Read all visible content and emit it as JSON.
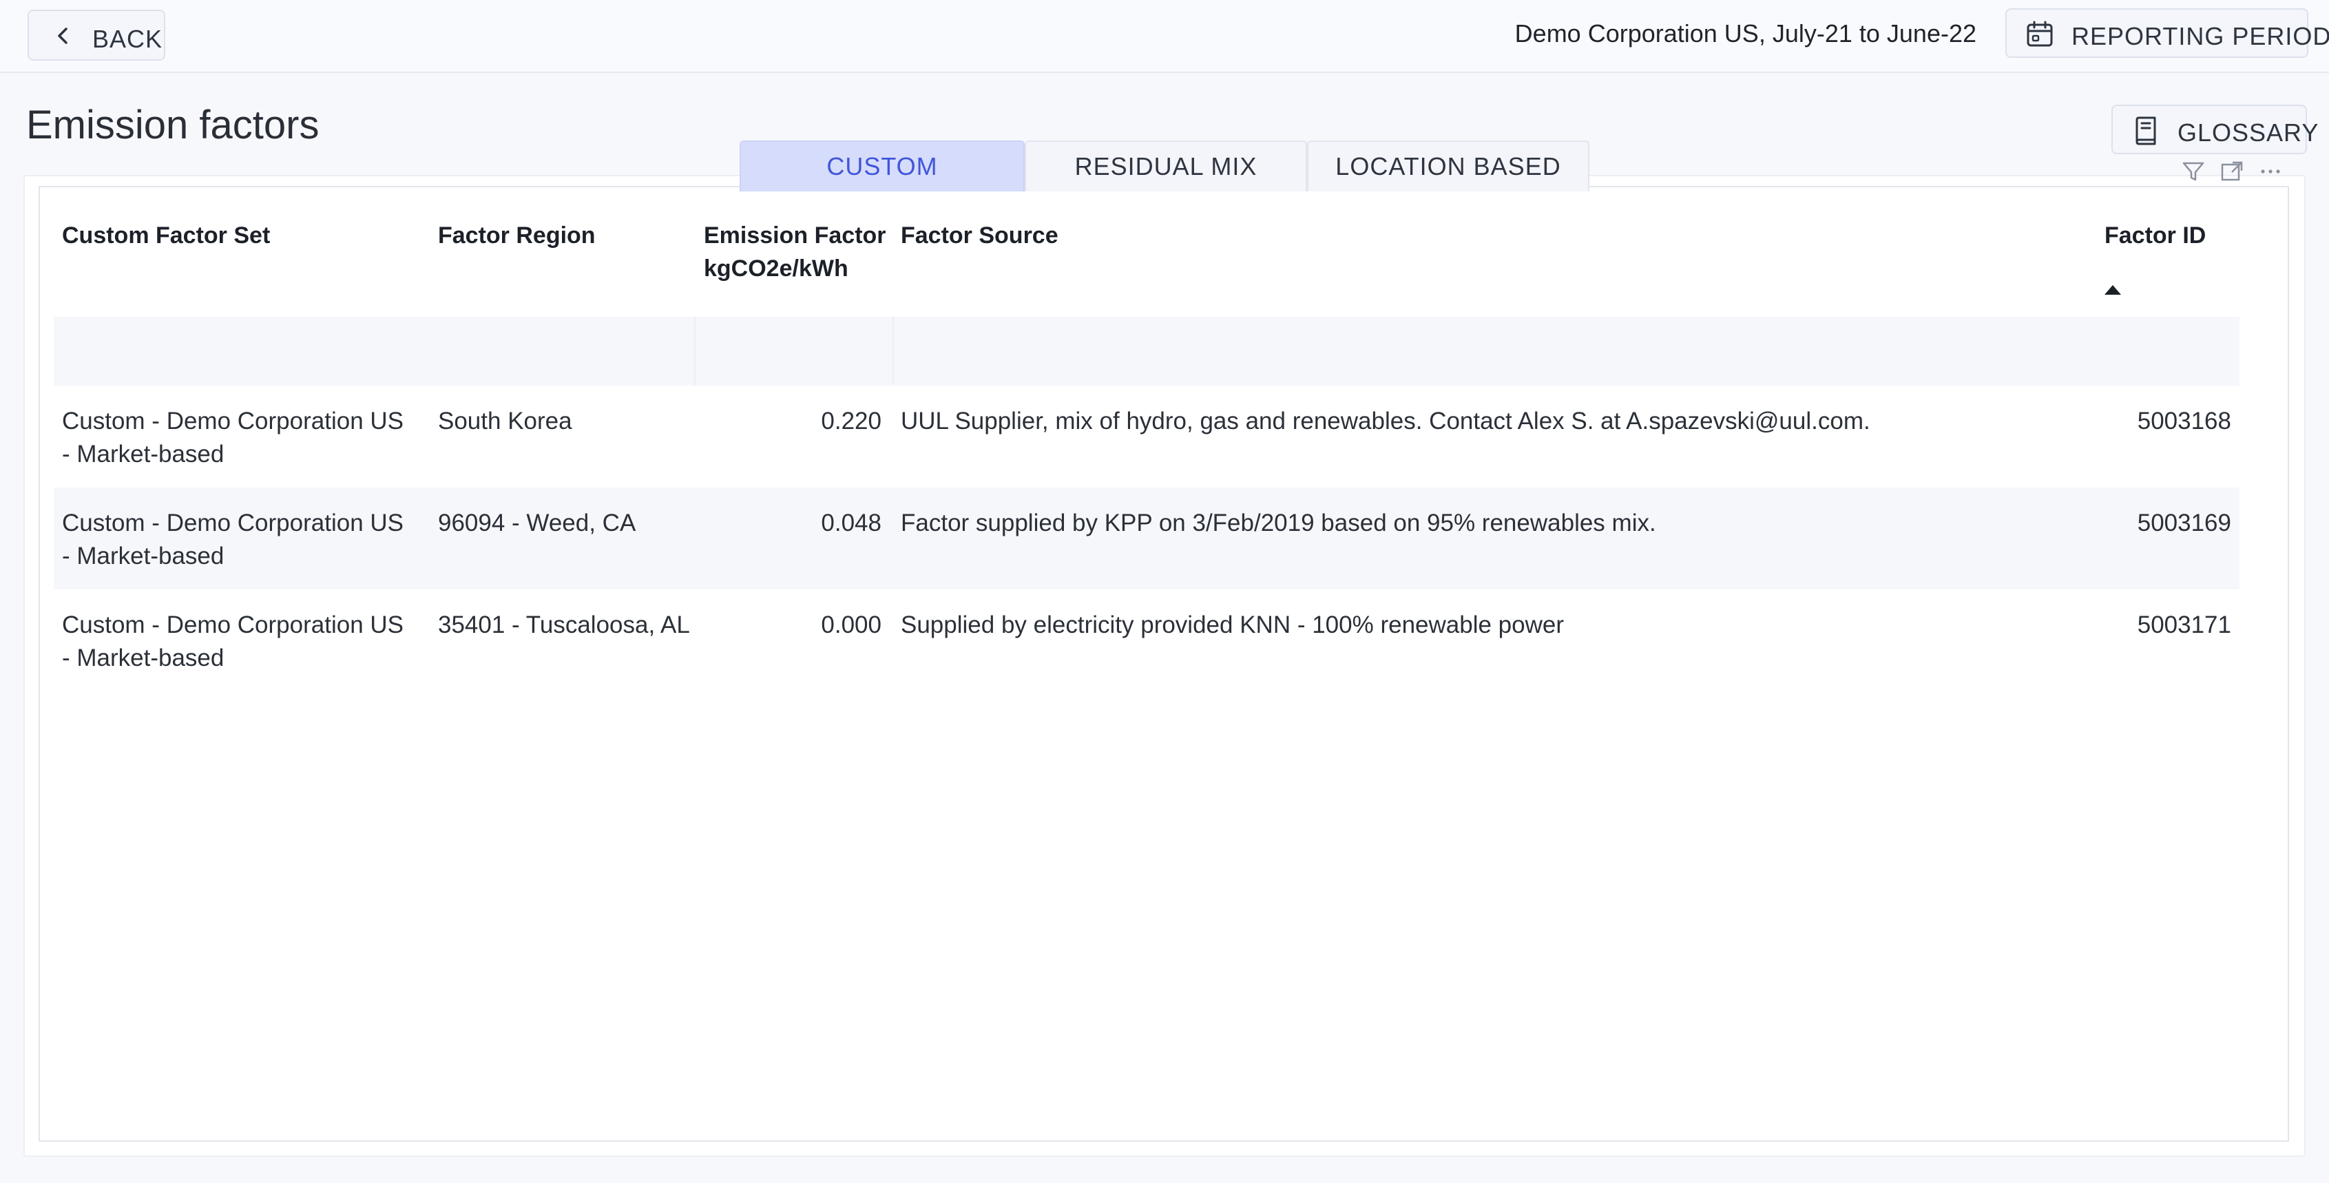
{
  "header": {
    "back_label": "BACK",
    "org_period": "Demo Corporation US, July-21 to June-22",
    "reporting_period_label": "REPORTING PERIOD"
  },
  "page": {
    "title": "Emission factors",
    "glossary_label": "GLOSSARY"
  },
  "tabs": [
    {
      "label": "CUSTOM",
      "active": true
    },
    {
      "label": "RESIDUAL MIX",
      "active": false
    },
    {
      "label": "LOCATION BASED",
      "active": false
    }
  ],
  "toolbar_icons": [
    "filter-icon",
    "expand-icon",
    "more-options-icon"
  ],
  "table": {
    "columns": {
      "set": "Custom Factor Set",
      "region": "Factor Region",
      "ef_line1": "Emission Factor",
      "ef_line2": "kgCO2e/kWh",
      "source": "Factor Source",
      "id": "Factor ID"
    },
    "sort_column": "Factor ID",
    "sort_direction": "ascending",
    "rows": [
      {
        "set_line1": "Custom - Demo Corporation US",
        "set_line2": "- Market-based",
        "region": "South Korea",
        "ef": "0.220",
        "source": "UUL Supplier, mix of hydro, gas and renewables. Contact Alex S. at A.spazevski@uul.com.",
        "id": "5003168"
      },
      {
        "set_line1": "Custom - Demo Corporation US",
        "set_line2": "- Market-based",
        "region": "96094 - Weed, CA",
        "ef": "0.048",
        "source": "Factor supplied by KPP on 3/Feb/2019 based on 95% renewables mix.",
        "id": "5003169"
      },
      {
        "set_line1": "Custom - Demo Corporation US",
        "set_line2": "- Market-based",
        "region": "35401 - Tuscaloosa, AL",
        "ef": "0.000",
        "source": "Supplied by electricity provided KNN - 100% renewable power",
        "id": "5003171"
      }
    ]
  },
  "colors": {
    "active_tab_bg": "#d6dcfb",
    "active_tab_text": "#4056d9",
    "page_bg": "#f7f8fc",
    "row_alt_bg": "#f6f7fb"
  }
}
